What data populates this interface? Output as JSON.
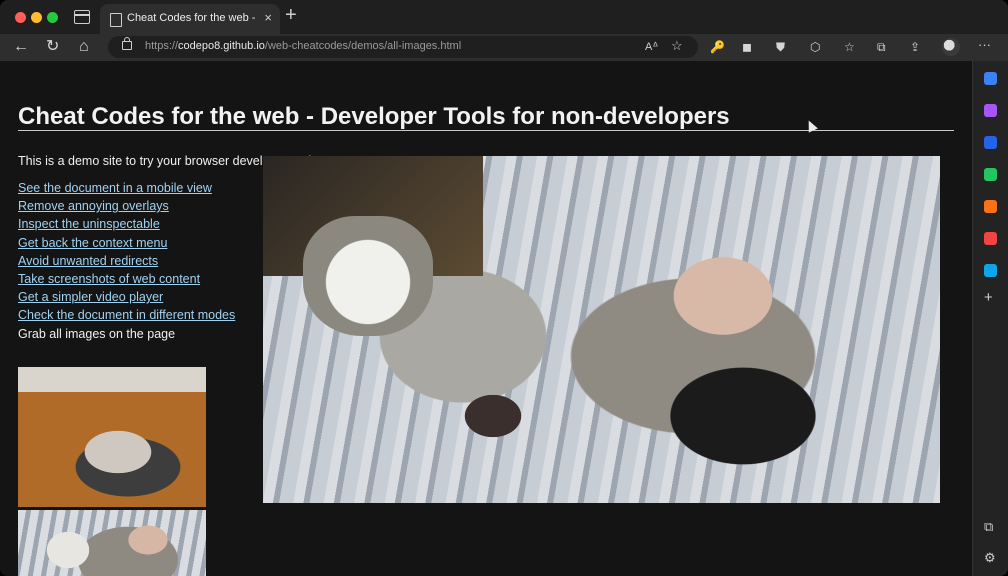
{
  "browser": {
    "tab": {
      "title": "Cheat Codes for the web - Developer Tools for non-developers",
      "close_icon": "×"
    },
    "new_tab_icon": "+",
    "toolbar": {
      "back_icon": "←",
      "refresh_icon": "↻",
      "home_icon": "⌂",
      "url_prefix": "https://",
      "url_host": "codepo8.github.io",
      "url_path": "/web-cheatcodes/demos/all-images.html",
      "read_aloud_icon": "Aᐞ",
      "add_favorite_icon": "☆",
      "more_icon": "···"
    },
    "extensions": [
      "🔑",
      "◼",
      "⛊",
      "⬡",
      "☆",
      "⧉",
      "⇪"
    ]
  },
  "page": {
    "title": "Cheat Codes for the web - Developer Tools for non-developers",
    "intro": "This is a demo site to try your browser developer tools on.",
    "links": [
      "See the document in a mobile view",
      "Remove annoying overlays",
      "Inspect the uninspectable",
      "Get back the context menu",
      "Avoid unwanted redirects",
      "Take screenshots of web content",
      "Get a simpler video player",
      "Check the document in different modes"
    ],
    "current_item": "Grab all images on the page"
  },
  "sidebar": {
    "icon_colors": [
      "#3b82f6",
      "#a855f7",
      "#2563eb",
      "#22c55e",
      "#f97316",
      "#ef4444",
      "#0ea5e9"
    ],
    "add_icon": "+",
    "bottom_icons": [
      "⧉",
      "⚙"
    ]
  }
}
